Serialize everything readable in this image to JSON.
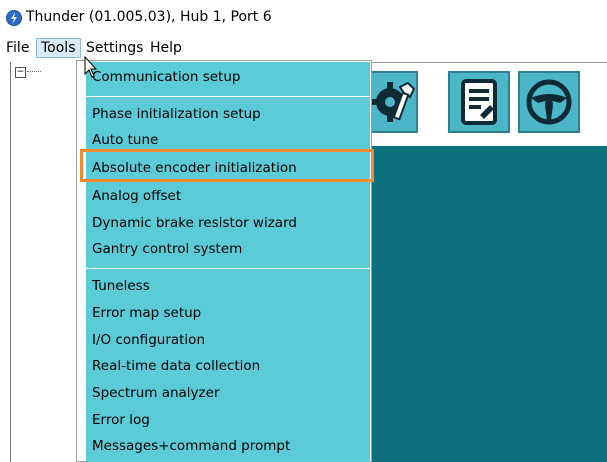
{
  "window": {
    "title": "Thunder (01.005.03), Hub 1, Port 6"
  },
  "menubar": {
    "items": [
      {
        "label": "File"
      },
      {
        "label": "Tools"
      },
      {
        "label": "Settings"
      },
      {
        "label": "Help"
      }
    ],
    "active": "Tools"
  },
  "tree": {
    "toggle": "⊟"
  },
  "toolbar": {
    "buttons": [
      {
        "icon": "wrench-gear-icon"
      },
      {
        "icon": "document-pen-icon"
      },
      {
        "icon": "steering-wheel-icon"
      }
    ]
  },
  "tools_menu": {
    "items": [
      {
        "label": "Communication setup"
      },
      {
        "label": "Phase initialization setup"
      },
      {
        "label": "Auto tune"
      },
      {
        "label": "Absolute encoder initialization",
        "highlighted": true
      },
      {
        "label": "Analog offset"
      },
      {
        "label": "Dynamic brake resistor wizard"
      },
      {
        "label": "Gantry control system"
      },
      {
        "label": "Tuneless"
      },
      {
        "label": "Error map setup"
      },
      {
        "label": "I/O configuration"
      },
      {
        "label": "Real-time data collection"
      },
      {
        "label": "Spectrum analyzer"
      },
      {
        "label": "Error log"
      },
      {
        "label": "Messages+command prompt"
      }
    ]
  },
  "colors": {
    "menu_bg": "#5ccbd8",
    "panel_bg": "#0e7180",
    "highlight": "#f28a30",
    "tool_button": "#4cb6c9"
  }
}
